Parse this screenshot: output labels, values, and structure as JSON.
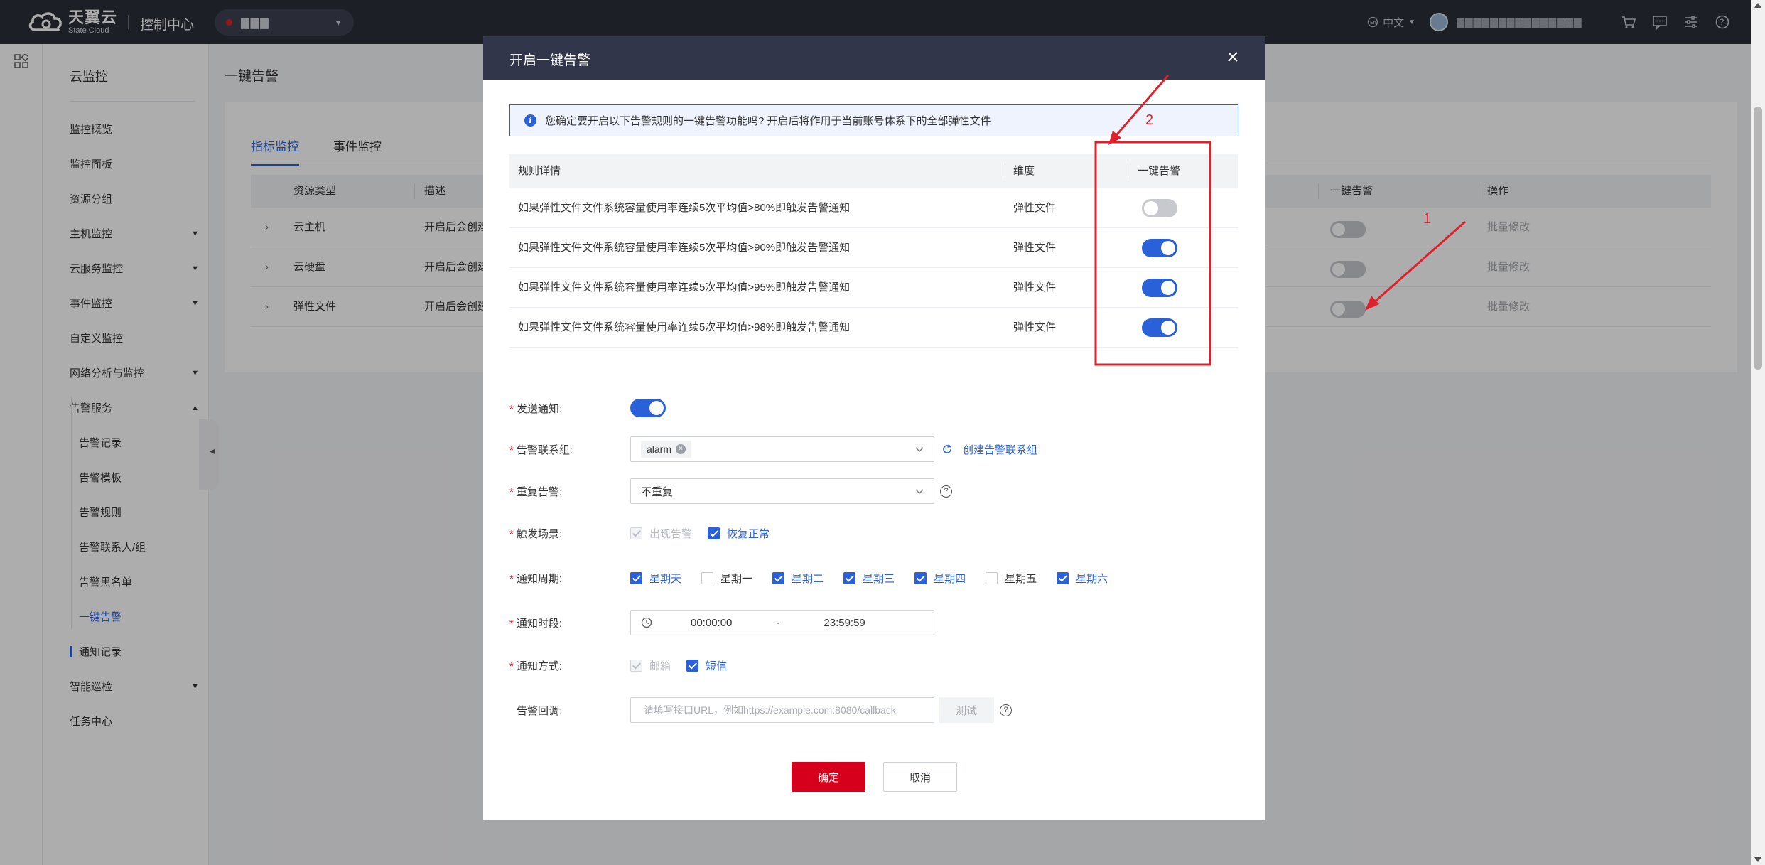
{
  "topbar": {
    "brand_cn": "天翼云",
    "brand_en": "State Cloud",
    "console_title": "控制中心",
    "region_text": "▇▇▇",
    "lang_label": "中文",
    "user_name": "▇▇▇▇▇▇▇▇▇▇▇▇▇▇▇",
    "icons": [
      "cart-icon",
      "message-icon",
      "settings-sliders-icon",
      "help-icon"
    ]
  },
  "sidebar": {
    "title": "云监控",
    "items": [
      {
        "label": "监控概览",
        "caret": ""
      },
      {
        "label": "监控面板",
        "caret": ""
      },
      {
        "label": "资源分组",
        "caret": ""
      },
      {
        "label": "主机监控",
        "caret": "▼"
      },
      {
        "label": "云服务监控",
        "caret": "▼"
      },
      {
        "label": "事件监控",
        "caret": "▼"
      },
      {
        "label": "自定义监控",
        "caret": ""
      },
      {
        "label": "网络分析与监控",
        "caret": "▼"
      },
      {
        "label": "告警服务",
        "caret": "▲"
      }
    ],
    "sub_items": [
      "告警记录",
      "告警模板",
      "告警规则",
      "告警联系人/组",
      "告警黑名单",
      "一键告警",
      "通知记录"
    ],
    "bottom_items": [
      {
        "label": "智能巡检",
        "caret": "▼"
      },
      {
        "label": "任务中心",
        "caret": ""
      }
    ]
  },
  "page": {
    "title": "一键告警",
    "tabs": [
      "指标监控",
      "事件监控"
    ],
    "table_headers": {
      "type": "资源类型",
      "desc": "描述",
      "toggle": "一键告警",
      "ops": "操作"
    },
    "rows": [
      {
        "type": "云主机",
        "desc": "开启后会创建",
        "op": "批量修改"
      },
      {
        "type": "云硬盘",
        "desc": "开启后会创建",
        "op": "批量修改"
      },
      {
        "type": "弹性文件",
        "desc": "开启后会创建",
        "op": "批量修改"
      }
    ]
  },
  "modal": {
    "title": "开启一键告警",
    "notice": "您确定要开启以下告警规则的一键告警功能吗? 开启后将作用于当前账号体系下的全部弹性文件",
    "rules_headers": {
      "detail": "规则详情",
      "dim": "维度",
      "toggle": "一键告警"
    },
    "rules": [
      {
        "detail": "如果弹性文件文件系统容量使用率连续5次平均值>80%即触发告警通知",
        "dim": "弹性文件",
        "enabled": false
      },
      {
        "detail": "如果弹性文件文件系统容量使用率连续5次平均值>90%即触发告警通知",
        "dim": "弹性文件",
        "enabled": true
      },
      {
        "detail": "如果弹性文件文件系统容量使用率连续5次平均值>95%即触发告警通知",
        "dim": "弹性文件",
        "enabled": true
      },
      {
        "detail": "如果弹性文件文件系统容量使用率连续5次平均值>98%即触发告警通知",
        "dim": "弹性文件",
        "enabled": true
      }
    ],
    "form": {
      "send_notice_label": "发送通知:",
      "send_notice_on": true,
      "contact_group_label": "告警联系组:",
      "contact_group_tag": "alarm",
      "create_group_link": "创建告警联系组",
      "repeat_label": "重复告警:",
      "repeat_value": "不重复",
      "trigger_label": "触发场景:",
      "trigger_options": [
        {
          "label": "出现告警",
          "state": "disabled"
        },
        {
          "label": "恢复正常",
          "state": "checked"
        }
      ],
      "cycle_label": "通知周期:",
      "cycle_options": [
        {
          "label": "星期天",
          "checked": true
        },
        {
          "label": "星期一",
          "checked": false
        },
        {
          "label": "星期二",
          "checked": true
        },
        {
          "label": "星期三",
          "checked": true
        },
        {
          "label": "星期四",
          "checked": true
        },
        {
          "label": "星期五",
          "checked": false
        },
        {
          "label": "星期六",
          "checked": true
        }
      ],
      "period_label": "通知时段:",
      "period_start": "00:00:00",
      "period_sep": "-",
      "period_end": "23:59:59",
      "method_label": "通知方式:",
      "method_options": [
        {
          "label": "邮箱",
          "state": "disabled"
        },
        {
          "label": "短信",
          "state": "checked"
        }
      ],
      "callback_label": "告警回调:",
      "callback_placeholder": "请填写接口URL，例如https://example.com:8080/callback",
      "test_label": "测试"
    },
    "ok_label": "确定",
    "cancel_label": "取消"
  },
  "annotations": {
    "marker_1": "1",
    "marker_2": "2",
    "color": "#e0202a"
  },
  "colors": {
    "primary": "#2a60d8",
    "danger": "#d6001c",
    "header": "#2b2f3a",
    "modal_header": "#31364a"
  }
}
